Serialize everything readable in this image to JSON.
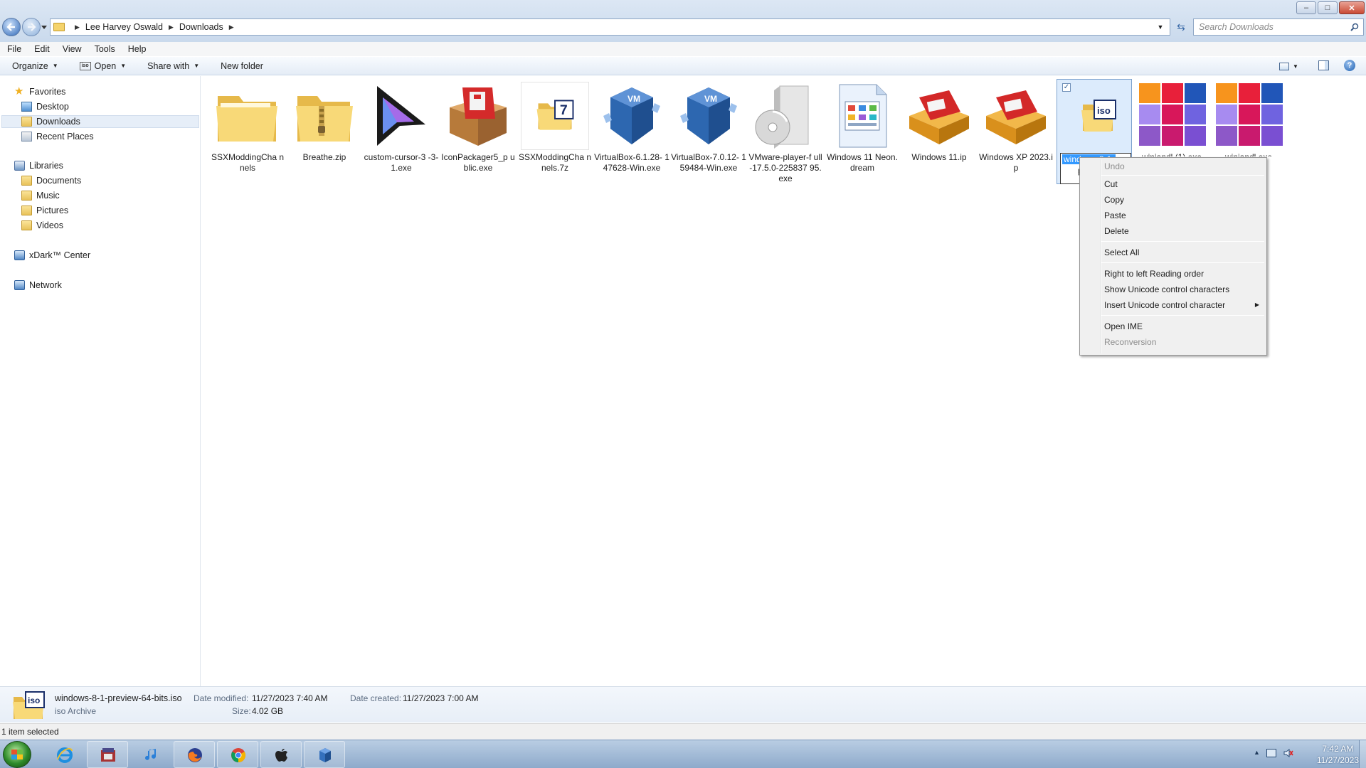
{
  "window": {
    "breadcrumb": [
      "Lee Harvey Oswald",
      "Downloads"
    ],
    "search_placeholder": "Search Downloads",
    "minimize": "–",
    "maximize": "□",
    "close": "✕"
  },
  "menubar": [
    "File",
    "Edit",
    "View",
    "Tools",
    "Help"
  ],
  "commandbar": {
    "organize": "Organize",
    "open": "Open",
    "share_with": "Share with",
    "new_folder": "New folder",
    "help": "?"
  },
  "navpane": {
    "favorites": "Favorites",
    "desktop": "Desktop",
    "downloads": "Downloads",
    "recent_places": "Recent Places",
    "libraries": "Libraries",
    "documents": "Documents",
    "music": "Music",
    "pictures": "Pictures",
    "videos": "Videos",
    "xdark": "xDark™ Center",
    "network": "Network"
  },
  "files": [
    {
      "name": "SSXModdingChannels",
      "label": "SSXModdingCha nnels",
      "icon": "folder-icon"
    },
    {
      "name": "Breathe.zip",
      "label": "Breathe.zip",
      "icon": "zip-folder-icon"
    },
    {
      "name": "custom-cursor-3-3-1.exe",
      "label": "custom-cursor-3 -3-1.exe",
      "icon": "cursor-app-icon"
    },
    {
      "name": "IconPackager5_public.exe",
      "label": "IconPackager5_p ublic.exe",
      "icon": "package-box-icon"
    },
    {
      "name": "SSXModdingChannels.7z",
      "label": "SSXModdingCha nnels.7z",
      "icon": "7z-archive-icon"
    },
    {
      "name": "VirtualBox-6.1.28-147628-Win.exe",
      "label": "VirtualBox-6.1.28- 147628-Win.exe",
      "icon": "virtualbox-icon"
    },
    {
      "name": "VirtualBox-7.0.12-159484-Win.exe",
      "label": "VirtualBox-7.0.12- 159484-Win.exe",
      "icon": "virtualbox-icon"
    },
    {
      "name": "VMware-player-full-17.5.0-22583795.exe",
      "label": "VMware-player-f ull-17.5.0-225837 95.exe",
      "icon": "disc-installer-icon"
    },
    {
      "name": "Windows 11 Neon.dream",
      "label": "Windows 11 Neon.dream",
      "icon": "document-icon"
    },
    {
      "name": "Windows 11.ip",
      "label": "Windows 11.ip",
      "icon": "package-box-icon"
    },
    {
      "name": "Windows XP 2023.ip",
      "label": "Windows XP 2023.ip",
      "icon": "package-box-icon"
    }
  ],
  "selected_file": {
    "rename_text": "windows-8-1-",
    "label_rest": "pr",
    "icon_text": "iso"
  },
  "partial_files": [
    {
      "label": "winiandl (1).exe"
    },
    {
      "label": "winiandl.exe"
    }
  ],
  "context_menu": {
    "undo": "Undo",
    "cut": "Cut",
    "copy": "Copy",
    "paste": "Paste",
    "delete": "Delete",
    "select_all": "Select All",
    "rtl": "Right to left Reading order",
    "show_unicode": "Show Unicode control characters",
    "insert_unicode": "Insert Unicode control character",
    "open_ime": "Open IME",
    "reconversion": "Reconversion"
  },
  "details": {
    "icon_text": "iso",
    "filename": "windows-8-1-preview-64-bits.iso",
    "type": "iso Archive",
    "date_modified_label": "Date modified:",
    "date_modified": "11/27/2023 7:40 AM",
    "size_label": "Size:",
    "size": "4.02 GB",
    "date_created_label": "Date created:",
    "date_created": "11/27/2023 7:00 AM"
  },
  "statusbar": "1 item selected",
  "taskbar": {
    "apps": [
      "ie-icon",
      "archive-app-icon",
      "itunes-icon",
      "firefox-icon",
      "chrome-icon",
      "mac-app-icon",
      "virtualbox-icon"
    ],
    "time": "7:42 AM",
    "date": "11/27/2023"
  }
}
